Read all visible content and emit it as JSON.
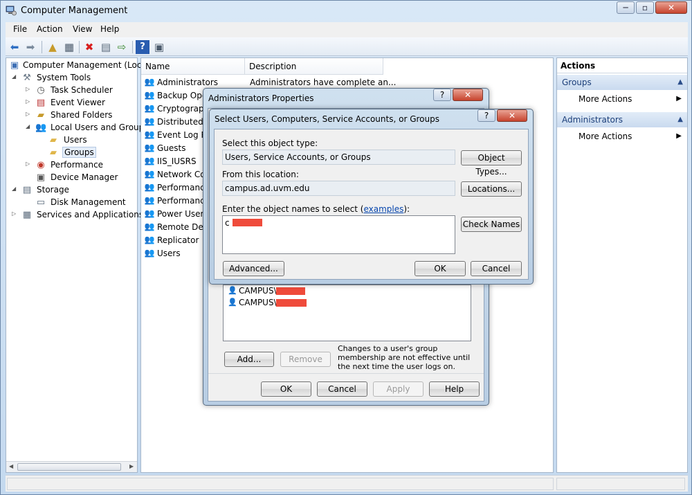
{
  "window": {
    "title": "Computer Management",
    "min": "─",
    "max": "▫",
    "close": "✕",
    "app_icon": "computer-management-icon"
  },
  "menu": [
    "File",
    "Action",
    "View",
    "Help"
  ],
  "toolbar": {
    "icons": [
      "back-arrow-icon",
      "forward-arrow-icon",
      "up-folder-icon",
      "show-hide-tree-icon",
      "delete-icon",
      "properties-icon",
      "export-list-icon",
      "help-icon",
      "show-hide-action-pane-icon"
    ]
  },
  "tree": {
    "items": [
      {
        "label": "Computer Management (Local",
        "icon": "computer-icon"
      },
      {
        "label": "System Tools",
        "icon": "tools-icon"
      },
      {
        "label": "Task Scheduler",
        "icon": "clock-icon"
      },
      {
        "label": "Event Viewer",
        "icon": "event-viewer-icon"
      },
      {
        "label": "Shared Folders",
        "icon": "shared-folder-icon"
      },
      {
        "label": "Local Users and Groups",
        "icon": "users-icon"
      },
      {
        "label": "Users",
        "icon": "folder-icon"
      },
      {
        "label": "Groups",
        "icon": "folder-icon"
      },
      {
        "label": "Performance",
        "icon": "performance-icon"
      },
      {
        "label": "Device Manager",
        "icon": "device-manager-icon"
      },
      {
        "label": "Storage",
        "icon": "storage-icon"
      },
      {
        "label": "Disk Management",
        "icon": "disk-icon"
      },
      {
        "label": "Services and Applications",
        "icon": "services-icon"
      }
    ]
  },
  "list": {
    "columns": {
      "name": "Name",
      "description": "Description"
    },
    "rows": [
      {
        "name": "Administrators",
        "description": "Administrators have complete an..."
      },
      {
        "name": "Backup Oper",
        "description": ""
      },
      {
        "name": "Cryptograph",
        "description": ""
      },
      {
        "name": "Distributed C",
        "description": ""
      },
      {
        "name": "Event Log Re",
        "description": ""
      },
      {
        "name": "Guests",
        "description": ""
      },
      {
        "name": "IIS_IUSRS",
        "description": ""
      },
      {
        "name": "Network Con",
        "description": ""
      },
      {
        "name": "Performance",
        "description": ""
      },
      {
        "name": "Performance",
        "description": ""
      },
      {
        "name": "Power Users",
        "description": ""
      },
      {
        "name": "Remote Desk",
        "description": ""
      },
      {
        "name": "Replicator",
        "description": ""
      },
      {
        "name": "Users",
        "description": ""
      }
    ]
  },
  "actions": {
    "header": "Actions",
    "sections": [
      {
        "title": "Groups",
        "items": [
          "More Actions"
        ]
      },
      {
        "title": "Administrators",
        "items": [
          "More Actions"
        ]
      }
    ]
  },
  "admin_dialog": {
    "title": "Administrators Properties",
    "help": "?",
    "close": "✕",
    "members": [
      "CAMPUS\\",
      "CAMPUS\\"
    ],
    "add_label": "Add...",
    "remove_label": "Remove",
    "note": "Changes to a user's group membership are not effective until the next time the user logs on.",
    "ok_label": "OK",
    "cancel_label": "Cancel",
    "apply_label": "Apply",
    "help_label": "Help"
  },
  "select_dialog": {
    "title": "Select Users, Computers, Service Accounts, or Groups",
    "help": "?",
    "close": "✕",
    "object_type_label": "Select this object type:",
    "object_type_value": "Users, Service Accounts, or Groups",
    "object_types_button": "Object Types...",
    "location_label": "From this location:",
    "location_value": "campus.ad.uvm.edu",
    "locations_button": "Locations...",
    "names_label_prefix": "Enter the object names to select (",
    "names_label_link": "examples",
    "names_label_suffix": "):",
    "names_value": "c",
    "check_names_button": "Check Names",
    "advanced_button": "Advanced...",
    "ok_label": "OK",
    "cancel_label": "Cancel",
    "redaction_color": "#ef4b3b"
  }
}
